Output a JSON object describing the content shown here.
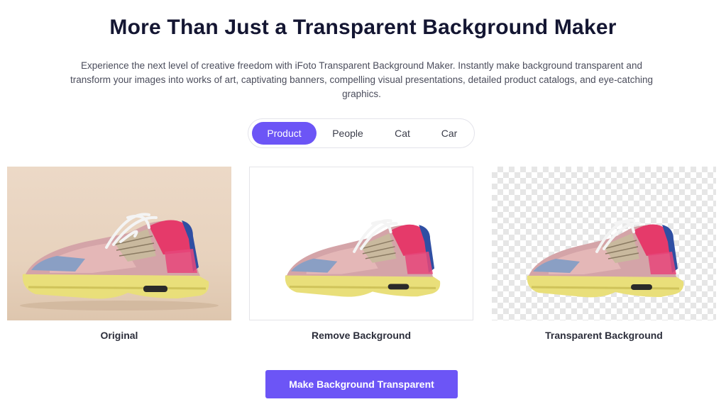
{
  "header": {
    "title": "More Than Just a Transparent Background Maker",
    "subtitle": "Experience the next level of creative freedom with iFoto Transparent Background Maker. Instantly make background transparent and transform your images into works of art, captivating banners, compelling visual presentations, detailed product catalogs, and eye-catching graphics."
  },
  "tabs": [
    {
      "label": "Product",
      "active": true
    },
    {
      "label": "People",
      "active": false
    },
    {
      "label": "Cat",
      "active": false
    },
    {
      "label": "Car",
      "active": false
    }
  ],
  "panels": [
    {
      "caption": "Original",
      "background": "beige-photo"
    },
    {
      "caption": "Remove Background",
      "background": "white"
    },
    {
      "caption": "Transparent Background",
      "background": "checkerboard"
    }
  ],
  "cta": {
    "label": "Make Background Transparent"
  },
  "colors": {
    "accent": "#6c55f6",
    "title": "#141632",
    "body_text": "#4b4d5c"
  }
}
